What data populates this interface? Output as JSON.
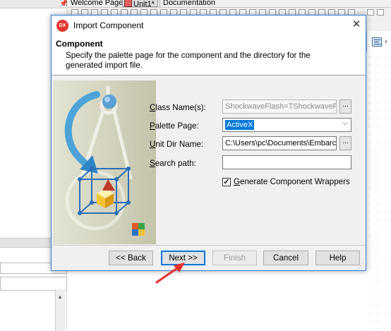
{
  "ide": {
    "tabs": [
      {
        "label": "Welcome Page"
      },
      {
        "label": "Unit1*"
      },
      {
        "label": "Documentation"
      }
    ]
  },
  "dialog": {
    "title": "Import Component",
    "header": {
      "title": "Component",
      "description": "Specify the palette page for the component and the directory for the generated import file."
    },
    "fields": {
      "class_name": {
        "label_key": "C",
        "label_rest": "lass Name(s):",
        "value": "ShockwaveFlash=TShockwaveFlas",
        "button": "..."
      },
      "palette_page": {
        "label_key": "P",
        "label_rest": "alette Page:",
        "value": "ActiveX"
      },
      "unit_dir": {
        "label_key": "U",
        "label_rest": "nit Dir Name:",
        "value": "C:\\Users\\pc\\Documents\\Embarcad",
        "button": "..."
      },
      "search_path": {
        "label_key": "S",
        "label_rest": "earch path:",
        "value": ""
      }
    },
    "generate_wrappers": {
      "label_key": "G",
      "label_rest": "enerate Component Wrappers",
      "checked": true,
      "mark": "✓"
    },
    "buttons": {
      "back": "<< Back",
      "next": "Next >>",
      "finish": "Finish",
      "cancel": "Cancel",
      "help": "Help"
    }
  },
  "colors": {
    "dialog_border": "#2b7fd8",
    "selection": "#0078d7",
    "logo_red": "#e4342f",
    "annotation_arrow": "#e8302a"
  },
  "icons": [
    "pin-icon",
    "close-icon",
    "dx-logo-icon",
    "chevron-down-icon",
    "align-icon",
    "resize-grip-icon",
    "red-arrow-icon"
  ]
}
